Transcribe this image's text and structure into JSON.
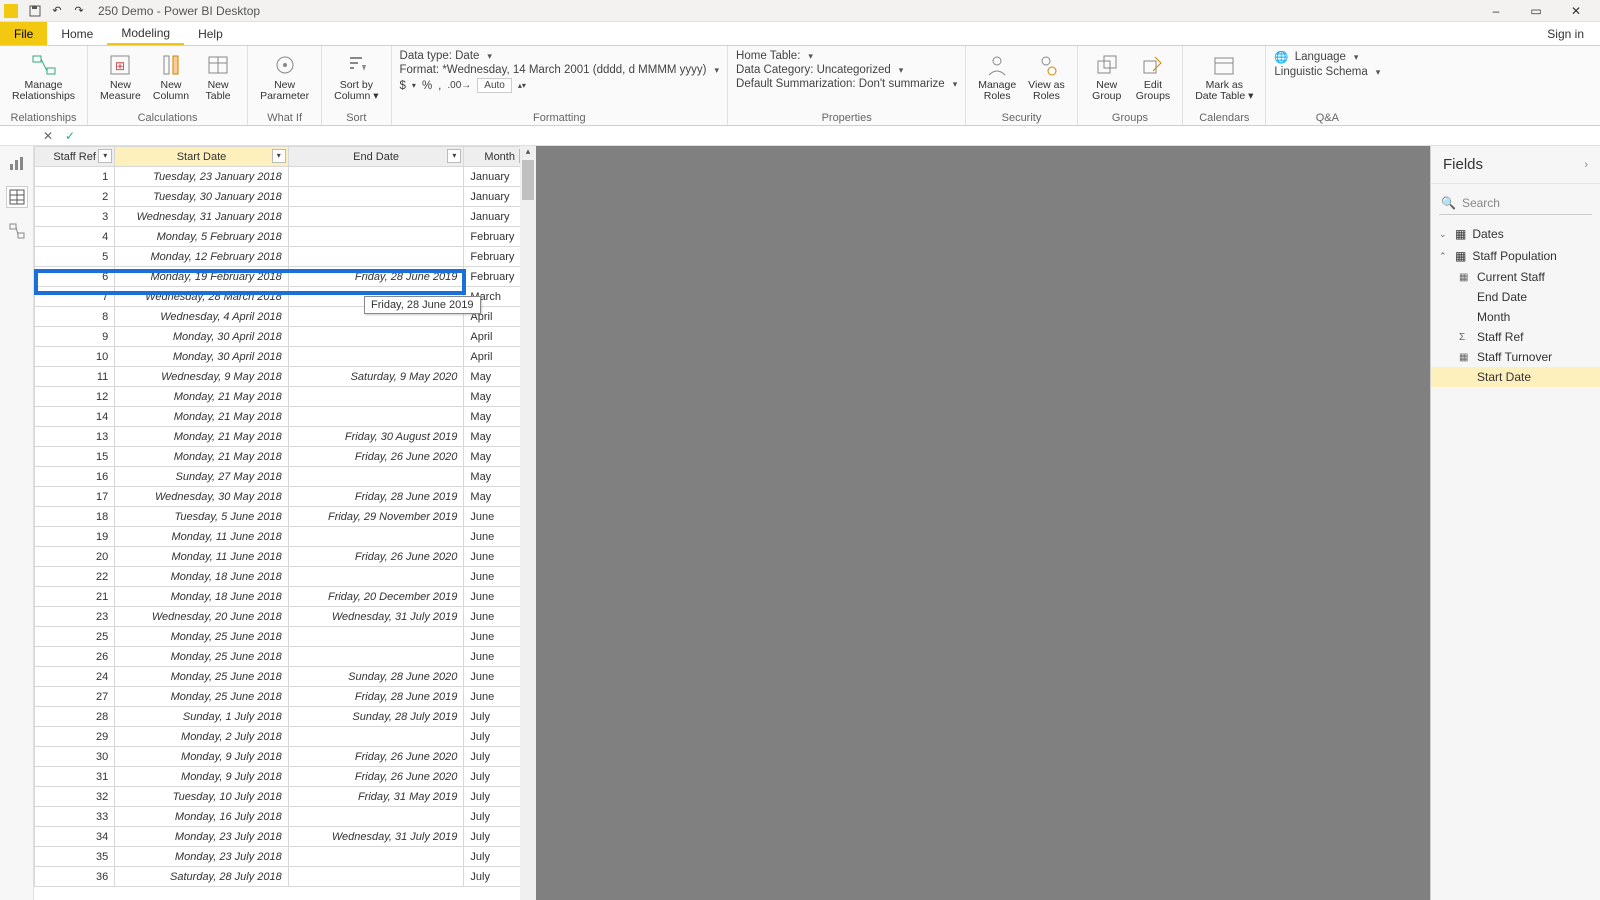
{
  "title": "250 Demo - Power BI Desktop",
  "qat": [
    "save-icon",
    "undo-icon",
    "redo-icon"
  ],
  "win": {
    "min": "–",
    "max": "▭",
    "close": "✕"
  },
  "tabs": {
    "file": "File",
    "home": "Home",
    "modeling": "Modeling",
    "help": "Help",
    "signin": "Sign in"
  },
  "ribbon": {
    "relationships": {
      "manage": "Manage\nRelationships",
      "group": "Relationships"
    },
    "calculations": {
      "measure": "New\nMeasure",
      "column": "New\nColumn",
      "table": "New\nTable",
      "group": "Calculations"
    },
    "whatif": {
      "param": "New\nParameter",
      "group": "What If"
    },
    "sort": {
      "btn": "Sort by\nColumn",
      "group": "Sort"
    },
    "formatting": {
      "datatype": "Data type: Date",
      "format": "Format: *Wednesday, 14 March 2001 (dddd, d MMMM yyyy)",
      "currency": "$",
      "percent": "%",
      "comma": ",",
      "decimals": "Auto",
      "hometable": "Home Table:",
      "datacat": "Data Category: Uncategorized",
      "defsum": "Default Summarization: Don't summarize",
      "group": "Formatting"
    },
    "properties": {
      "group": "Properties"
    },
    "security": {
      "manageroles": "Manage\nRoles",
      "viewas": "View as\nRoles",
      "group": "Security"
    },
    "groups": {
      "new": "New\nGroup",
      "edit": "Edit\nGroups",
      "group": "Groups"
    },
    "calendars": {
      "mark": "Mark as\nDate Table",
      "group": "Calendars"
    },
    "qa": {
      "lang": "Language",
      "ling": "Linguistic Schema",
      "group": "Q&A"
    }
  },
  "columns": {
    "c1": "Staff Ref",
    "c2": "Start Date",
    "c3": "End Date",
    "c4": "Month"
  },
  "tooltip": "Friday, 28 June 2019",
  "rows": [
    {
      "r": "1",
      "s": "Tuesday, 23 January 2018",
      "e": "",
      "m": "January"
    },
    {
      "r": "2",
      "s": "Tuesday, 30 January 2018",
      "e": "",
      "m": "January"
    },
    {
      "r": "3",
      "s": "Wednesday, 31 January 2018",
      "e": "",
      "m": "January"
    },
    {
      "r": "4",
      "s": "Monday, 5 February 2018",
      "e": "",
      "m": "February"
    },
    {
      "r": "5",
      "s": "Monday, 12 February 2018",
      "e": "",
      "m": "February"
    },
    {
      "r": "6",
      "s": "Monday, 19 February 2018",
      "e": "Friday, 28 June 2019",
      "m": "February"
    },
    {
      "r": "7",
      "s": "Wednesday, 28 March 2018",
      "e": "",
      "m": "March"
    },
    {
      "r": "8",
      "s": "Wednesday, 4 April 2018",
      "e": "",
      "m": "April"
    },
    {
      "r": "9",
      "s": "Monday, 30 April 2018",
      "e": "",
      "m": "April"
    },
    {
      "r": "10",
      "s": "Monday, 30 April 2018",
      "e": "",
      "m": "April"
    },
    {
      "r": "11",
      "s": "Wednesday, 9 May 2018",
      "e": "Saturday, 9 May 2020",
      "m": "May"
    },
    {
      "r": "12",
      "s": "Monday, 21 May 2018",
      "e": "",
      "m": "May"
    },
    {
      "r": "14",
      "s": "Monday, 21 May 2018",
      "e": "",
      "m": "May"
    },
    {
      "r": "13",
      "s": "Monday, 21 May 2018",
      "e": "Friday, 30 August 2019",
      "m": "May"
    },
    {
      "r": "15",
      "s": "Monday, 21 May 2018",
      "e": "Friday, 26 June 2020",
      "m": "May"
    },
    {
      "r": "16",
      "s": "Sunday, 27 May 2018",
      "e": "",
      "m": "May"
    },
    {
      "r": "17",
      "s": "Wednesday, 30 May 2018",
      "e": "Friday, 28 June 2019",
      "m": "May"
    },
    {
      "r": "18",
      "s": "Tuesday, 5 June 2018",
      "e": "Friday, 29 November 2019",
      "m": "June"
    },
    {
      "r": "19",
      "s": "Monday, 11 June 2018",
      "e": "",
      "m": "June"
    },
    {
      "r": "20",
      "s": "Monday, 11 June 2018",
      "e": "Friday, 26 June 2020",
      "m": "June"
    },
    {
      "r": "22",
      "s": "Monday, 18 June 2018",
      "e": "",
      "m": "June"
    },
    {
      "r": "21",
      "s": "Monday, 18 June 2018",
      "e": "Friday, 20 December 2019",
      "m": "June"
    },
    {
      "r": "23",
      "s": "Wednesday, 20 June 2018",
      "e": "Wednesday, 31 July 2019",
      "m": "June"
    },
    {
      "r": "25",
      "s": "Monday, 25 June 2018",
      "e": "",
      "m": "June"
    },
    {
      "r": "26",
      "s": "Monday, 25 June 2018",
      "e": "",
      "m": "June"
    },
    {
      "r": "24",
      "s": "Monday, 25 June 2018",
      "e": "Sunday, 28 June 2020",
      "m": "June"
    },
    {
      "r": "27",
      "s": "Monday, 25 June 2018",
      "e": "Friday, 28 June 2019",
      "m": "June"
    },
    {
      "r": "28",
      "s": "Sunday, 1 July 2018",
      "e": "Sunday, 28 July 2019",
      "m": "July"
    },
    {
      "r": "29",
      "s": "Monday, 2 July 2018",
      "e": "",
      "m": "July"
    },
    {
      "r": "30",
      "s": "Monday, 9 July 2018",
      "e": "Friday, 26 June 2020",
      "m": "July"
    },
    {
      "r": "31",
      "s": "Monday, 9 July 2018",
      "e": "Friday, 26 June 2020",
      "m": "July"
    },
    {
      "r": "32",
      "s": "Tuesday, 10 July 2018",
      "e": "Friday, 31 May 2019",
      "m": "July"
    },
    {
      "r": "33",
      "s": "Monday, 16 July 2018",
      "e": "",
      "m": "July"
    },
    {
      "r": "34",
      "s": "Monday, 23 July 2018",
      "e": "Wednesday, 31 July 2019",
      "m": "July"
    },
    {
      "r": "35",
      "s": "Monday, 23 July 2018",
      "e": "",
      "m": "July"
    },
    {
      "r": "36",
      "s": "Saturday, 28 July 2018",
      "e": "",
      "m": "July"
    }
  ],
  "fields": {
    "title": "Fields",
    "search": "Search",
    "dates": "Dates",
    "staffpop": "Staff Population",
    "items": [
      {
        "icon": "calc",
        "label": "Current Staff"
      },
      {
        "icon": "",
        "label": "End Date"
      },
      {
        "icon": "",
        "label": "Month"
      },
      {
        "icon": "sum",
        "label": "Staff Ref"
      },
      {
        "icon": "calc",
        "label": "Staff Turnover"
      },
      {
        "icon": "",
        "label": "Start Date",
        "sel": true
      }
    ]
  }
}
